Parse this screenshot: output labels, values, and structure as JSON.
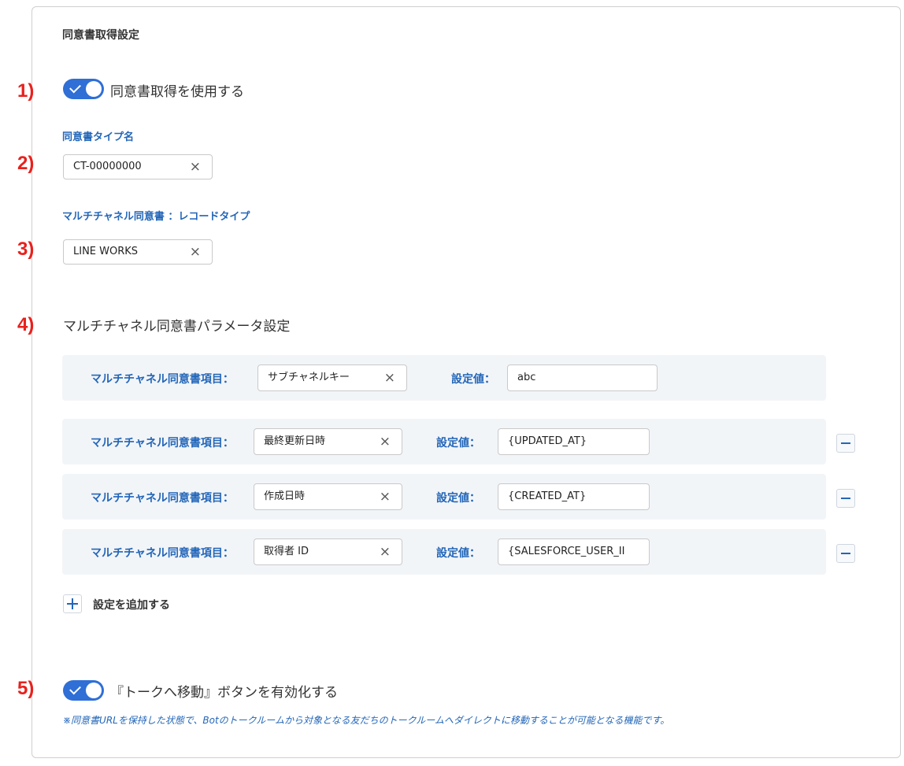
{
  "section_title": "同意書取得設定",
  "markers": [
    "1)",
    "2)",
    "3)",
    "4)",
    "5)"
  ],
  "consent_toggle": {
    "label": "同意書取得を使用する",
    "on": true
  },
  "consent_type": {
    "label": "同意書タイプ名",
    "value": "CT-00000000",
    "clear_icon": "×"
  },
  "record_type": {
    "label": "マルチチャネル同意書 ：レコードタイプ",
    "value": "LINE WORKS",
    "clear_icon": "×"
  },
  "params": {
    "title": "マルチチャネル同意書パラメータ設定",
    "rows": [
      {
        "item_label": "マルチチャネル同意書項目：",
        "item_value": "サブチャネルキー",
        "value_label": "設定値：",
        "value": "abc",
        "removable": false
      },
      {
        "item_label": "マルチチャネル同意書項目：",
        "item_value": "最終更新日時",
        "value_label": "設定値：",
        "value": "{UPDATED_AT}",
        "removable": true
      },
      {
        "item_label": "マルチチャネル同意書項目：",
        "item_value": "作成日時",
        "value_label": "設定値：",
        "value": "{CREATED_AT}",
        "removable": true
      },
      {
        "item_label": "マルチチャネル同意書項目：",
        "item_value": "取得者 ID",
        "value_label": "設定値：",
        "value": "{SALESFORCE_USER_II",
        "removable": true
      }
    ],
    "add_label": "設定を追加する",
    "clear_icon": "×"
  },
  "talk_toggle": {
    "label": "『トークへ移動』ボタンを有効化する",
    "on": true
  },
  "note": "※同意書URLを保持した状態で、Botのトークルームから対象となる友だちのトークルームへダイレクトに移動することが可能となる機能です。",
  "colors": {
    "accent": "#2f6fd6",
    "label_blue": "#2366b8",
    "marker_red": "#e8211d",
    "row_bg": "#f2f5f8"
  }
}
